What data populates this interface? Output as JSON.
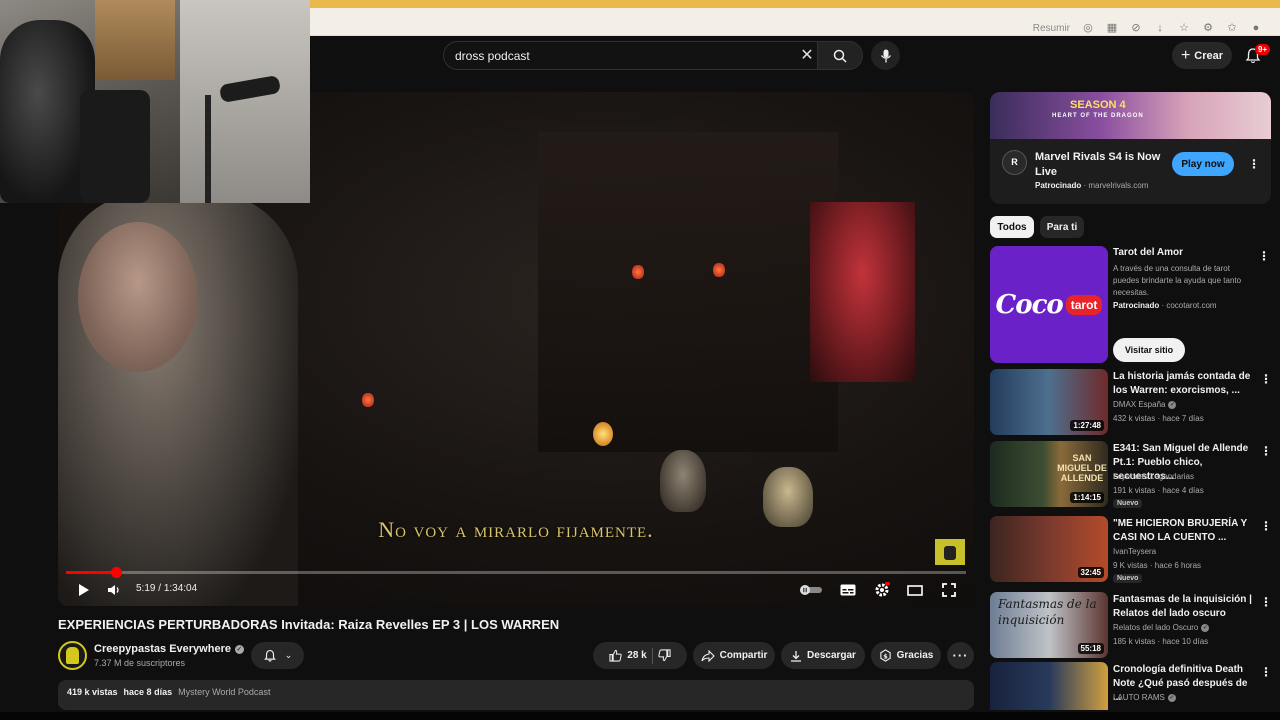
{
  "browser": {
    "summarize_label": "Resumir"
  },
  "header": {
    "search_value": "dross podcast",
    "create_label": "Crear",
    "notification_count": "9+"
  },
  "player": {
    "subtitle": "No voy a mirarlo fijamente.",
    "current_time": "5:19",
    "duration": "1:34:04",
    "progress": 0.056
  },
  "video": {
    "title": "EXPERIENCIAS PERTURBADORAS Invitada: Raiza Revelles EP 3 | LOS WARREN",
    "channel": "Creepypastas Everywhere",
    "subscribers": "7.37 M de suscriptores",
    "likes": "28 k",
    "share_label": "Compartir",
    "download_label": "Descargar",
    "thanks_label": "Gracias",
    "views": "419 k vistas",
    "published": "hace 8 días",
    "hashtag": "Mystery World Podcast"
  },
  "ad": {
    "banner_line1": "SEASON 4",
    "banner_line2": "HEART OF THE DRAGON",
    "logo_text": "R",
    "title": "Marvel Rivals S4 is Now Live",
    "sponsored": "Patrocinado",
    "domain": "marvelrivals.com",
    "cta": "Play now"
  },
  "chips": {
    "all": "Todos",
    "for_you": "Para ti"
  },
  "tarot_ad": {
    "logo_word": "Coco",
    "logo_tag": "tarot",
    "title": "Tarot del Amor",
    "description": "A través de una consulta de tarot puedes brindarte la ayuda que tanto necesitas.",
    "sponsored": "Patrocinado",
    "domain": "cocotarot.com",
    "cta": "Visitar sitio"
  },
  "recommendations": [
    {
      "title": "La historia jamás contada de los Warren: exorcismos, ...",
      "channel": "DMAX España",
      "stats": "432 k vistas · hace 7 días",
      "duration": "1:27:48",
      "badge": ""
    },
    {
      "title": "E341: San Miguel de Allende Pt.1: Pueblo chico, secuestros...",
      "channel": "Leyendas Legendarias",
      "stats": "191 k vistas · hace 4 días",
      "duration": "1:14:15",
      "badge": "Nuevo",
      "thumb_text": "SAN MIGUEL DE ALLENDE"
    },
    {
      "title": "\"ME HICIERON BRUJERÍA Y CASI NO LA CUENTO ...",
      "channel": "IvanTeysera",
      "stats": "9 K vistas · hace 6 horas",
      "duration": "32:45",
      "badge": "Nuevo"
    },
    {
      "title": "Fantasmas de la inquisición | Relatos del lado oscuro",
      "channel": "Relatos del lado Oscuro",
      "stats": "185 k vistas · hace 10 días",
      "duration": "55:18",
      "badge": "",
      "thumb_text": "Fantasmas de la inquisición"
    },
    {
      "title": "Cronología definitiva Death Note ¿Qué pasó después de ...",
      "channel": "LAUTO RAMS",
      "stats": "",
      "duration": "",
      "badge": ""
    }
  ],
  "colors": {
    "accent_red": "#ff0000",
    "play_now_blue": "#3ea6ff",
    "background": "#0f0f0f"
  }
}
